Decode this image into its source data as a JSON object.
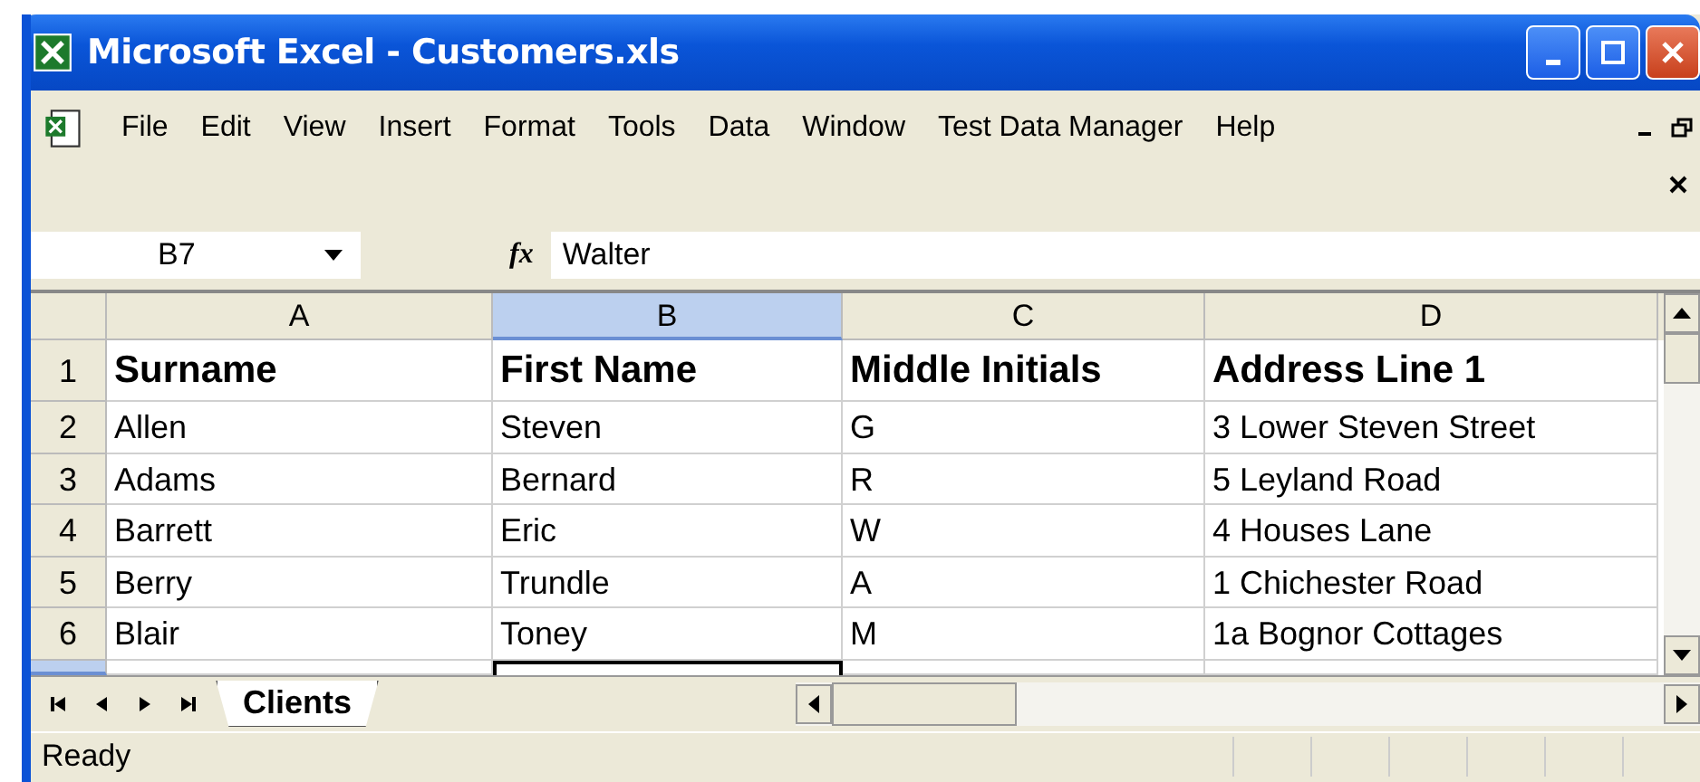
{
  "window": {
    "title": "Microsoft Excel - Customers.xls"
  },
  "menu": [
    "File",
    "Edit",
    "View",
    "Insert",
    "Format",
    "Tools",
    "Data",
    "Window",
    "Test Data Manager",
    "Help"
  ],
  "formula_bar": {
    "name_box": "B7",
    "function_label": "fx",
    "value": "Walter"
  },
  "columns": [
    {
      "label": "A",
      "selected": false
    },
    {
      "label": "B",
      "selected": true
    },
    {
      "label": "C",
      "selected": false
    },
    {
      "label": "D",
      "selected": false
    }
  ],
  "rows": [
    {
      "number": "1",
      "header": true,
      "cells": [
        "Surname",
        "First Name",
        "Middle Initials",
        "Address Line 1"
      ]
    },
    {
      "number": "2",
      "header": false,
      "cells": [
        "Allen",
        "Steven",
        "G",
        "3 Lower Steven Street"
      ]
    },
    {
      "number": "3",
      "header": false,
      "cells": [
        "Adams",
        "Bernard",
        "R",
        "5 Leyland Road"
      ]
    },
    {
      "number": "4",
      "header": false,
      "cells": [
        "Barrett",
        "Eric",
        "W",
        "4 Houses Lane"
      ]
    },
    {
      "number": "5",
      "header": false,
      "cells": [
        "Berry",
        "Trundle",
        "A",
        "1 Chichester Road"
      ]
    },
    {
      "number": "6",
      "header": false,
      "cells": [
        "Blair",
        "Toney",
        "M",
        "1a Bognor Cottages"
      ]
    }
  ],
  "partial_row": {
    "selected": true
  },
  "sheet_tabs": [
    {
      "label": "Clients",
      "selected": true
    }
  ],
  "status_bar": {
    "text": "Ready"
  }
}
